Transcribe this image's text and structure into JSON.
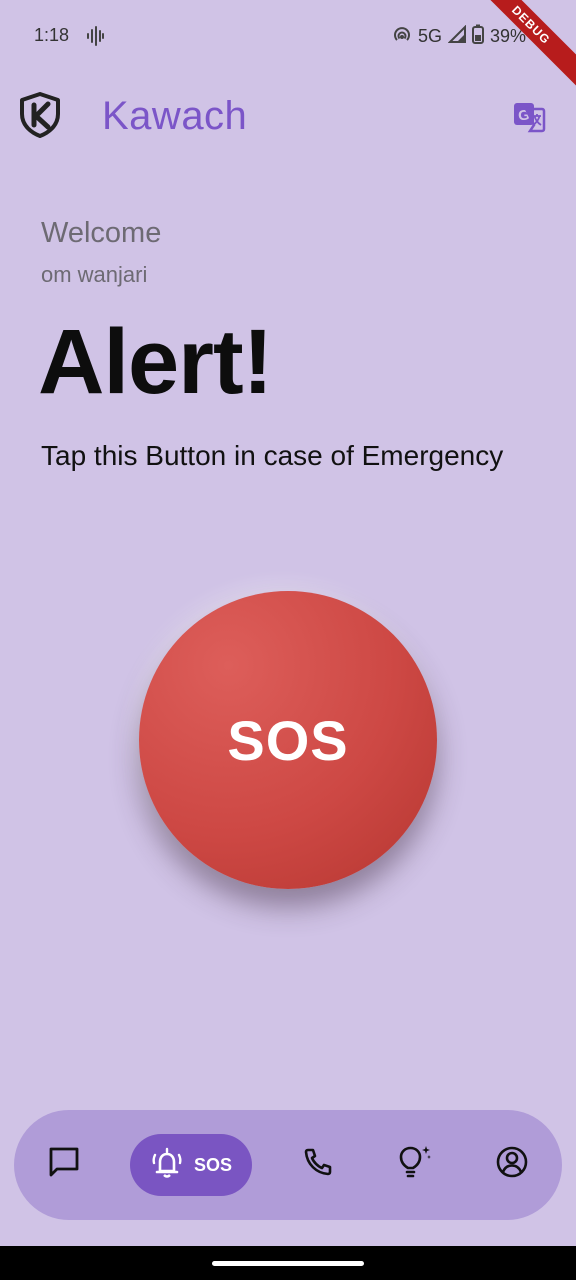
{
  "status_bar": {
    "time": "1:18",
    "network": "5G",
    "battery": "39%",
    "icons": [
      "voice-wave-icon",
      "hotspot-icon",
      "signal-icon",
      "battery-icon"
    ]
  },
  "debug_banner": "DEBUG",
  "app_bar": {
    "title": "Kawach",
    "logo_icon": "shield-k-logo-icon",
    "action_icon": "translate-icon"
  },
  "main": {
    "welcome": "Welcome",
    "username": "om wanjari",
    "alert_title": "Alert!",
    "instruction": "Tap this Button in case of Emergency",
    "sos_button_label": "SOS"
  },
  "bottom_nav": {
    "items": [
      {
        "icon": "chat-icon",
        "label": ""
      },
      {
        "icon": "alarm-bell-icon",
        "label": "SOS",
        "active": true
      },
      {
        "icon": "phone-icon",
        "label": ""
      },
      {
        "icon": "lightbulb-sparkle-icon",
        "label": ""
      },
      {
        "icon": "account-circle-icon",
        "label": ""
      }
    ]
  },
  "colors": {
    "background": "#d0c3e6",
    "accent": "#7b55c8",
    "sos_red": "#cd4844",
    "nav_bar": "#b09cd8",
    "nav_active": "#7a55c2"
  }
}
